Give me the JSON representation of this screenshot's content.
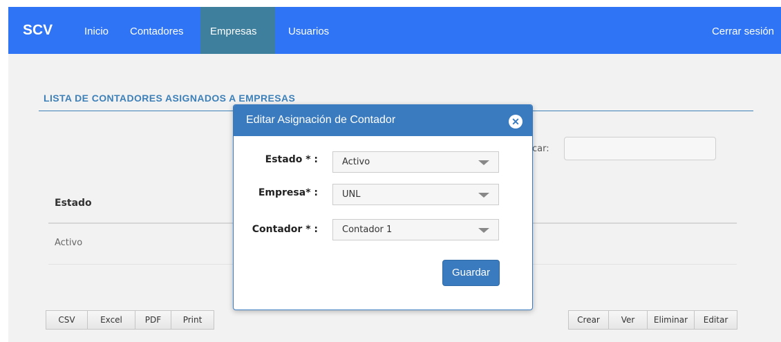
{
  "navbar": {
    "brand": "SCV",
    "items": [
      {
        "label": "Inicio",
        "active": false
      },
      {
        "label": "Contadores",
        "active": false
      },
      {
        "label": "Empresas",
        "active": true
      },
      {
        "label": "Usuarios",
        "active": false
      }
    ],
    "logout": "Cerrar sesión"
  },
  "page": {
    "title": "LISTA DE CONTADORES ASIGNADOS A EMPRESAS",
    "search_label": "car:",
    "search_value": ""
  },
  "table": {
    "columns": [
      "Estado"
    ],
    "rows": [
      [
        "Activo"
      ]
    ]
  },
  "export_buttons": [
    "CSV",
    "Excel",
    "PDF",
    "Print"
  ],
  "action_buttons": [
    "Crear",
    "Ver",
    "Eliminar",
    "Editar"
  ],
  "modal": {
    "title": "Editar Asignación de Contador",
    "close_glyph": "✕",
    "fields": [
      {
        "label": "Estado * :",
        "value": "Activo"
      },
      {
        "label": "Empresa* :",
        "value": "UNL"
      },
      {
        "label": "Contador * :",
        "value": "Contador 1"
      }
    ],
    "save_label": "Guardar"
  },
  "colors": {
    "navbar": "#2f74f5",
    "nav_active": "#3d7f9c",
    "accent": "#3a7bbf",
    "title": "#3d80b8"
  }
}
